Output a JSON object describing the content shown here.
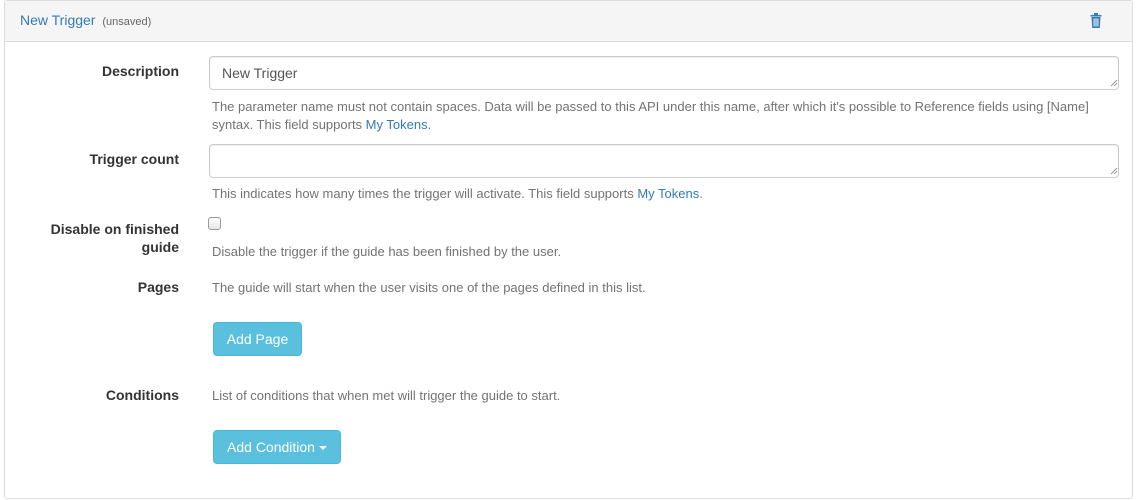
{
  "header": {
    "title": "New Trigger",
    "subtitle": "(unsaved)",
    "delete_icon": "trash-icon"
  },
  "form": {
    "description": {
      "label": "Description",
      "value": "New Trigger",
      "help_text": "The parameter name must not contain spaces. Data will be passed to this API under this name, after which it's possible to Reference fields using [Name] syntax. This field supports ",
      "help_link": "My Tokens",
      "help_suffix": "."
    },
    "trigger_count": {
      "label": "Trigger count",
      "value": "",
      "help_text": "This indicates how many times the trigger will activate. This field supports ",
      "help_link": "My Tokens",
      "help_suffix": "."
    },
    "disable_on_finished": {
      "label_line1": "Disable on finished",
      "label_line2": "guide",
      "checked": false,
      "help_text": "Disable the trigger if the guide has been finished by the user."
    },
    "pages": {
      "label": "Pages",
      "help_text": "The guide will start when the user visits one of the pages defined in this list.",
      "button_label": "Add Page"
    },
    "conditions": {
      "label": "Conditions",
      "help_text": "List of conditions that when met will trigger the guide to start.",
      "button_label": "Add Condition",
      "button_icon": "caret-down-icon"
    }
  },
  "colors": {
    "link": "#337ab7",
    "info_button": "#5bc0de",
    "help_text": "#737373"
  }
}
